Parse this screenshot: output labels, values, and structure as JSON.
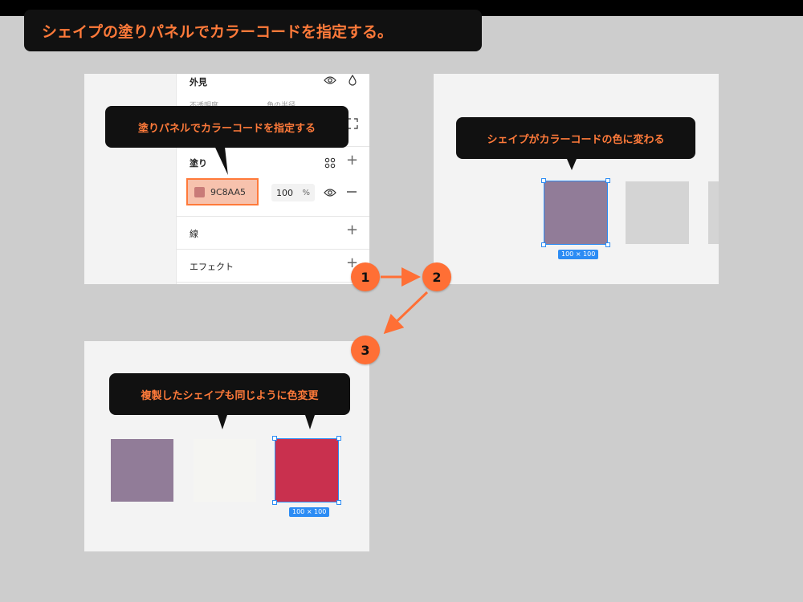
{
  "title": "シェイプの塗りパネルでカラーコードを指定する。",
  "panel1": {
    "appearance_label": "外見",
    "opacity_label": "不透明度",
    "corner_label": "角の半径",
    "fill_label": "塗り",
    "fill_hex": "9C8AA5",
    "fill_opacity": "100",
    "percent": "%",
    "stroke_label": "線",
    "effect_label": "エフェクト",
    "callout": "塗りパネルでカラーコードを指定する"
  },
  "panel2": {
    "callout": "シェイプがカラーコードの色に変わる",
    "size_label": "100 × 100"
  },
  "panel3": {
    "callout": "複製したシェイプも同じように色変更",
    "size_label": "100 × 100"
  },
  "steps": [
    "1",
    "2",
    "3"
  ],
  "colors": {
    "accent": "#ff7a3a",
    "shape_purple": "#917c98",
    "shape_red": "#c9304e",
    "shape_gray": "#d4d4d4",
    "shape_offwhite": "#f5f5f2",
    "selection": "#2c8cf4"
  },
  "icons": [
    "eye-icon",
    "droplet-icon",
    "expand-corners-icon",
    "grid-dots-icon",
    "plus-icon",
    "minus-icon"
  ]
}
